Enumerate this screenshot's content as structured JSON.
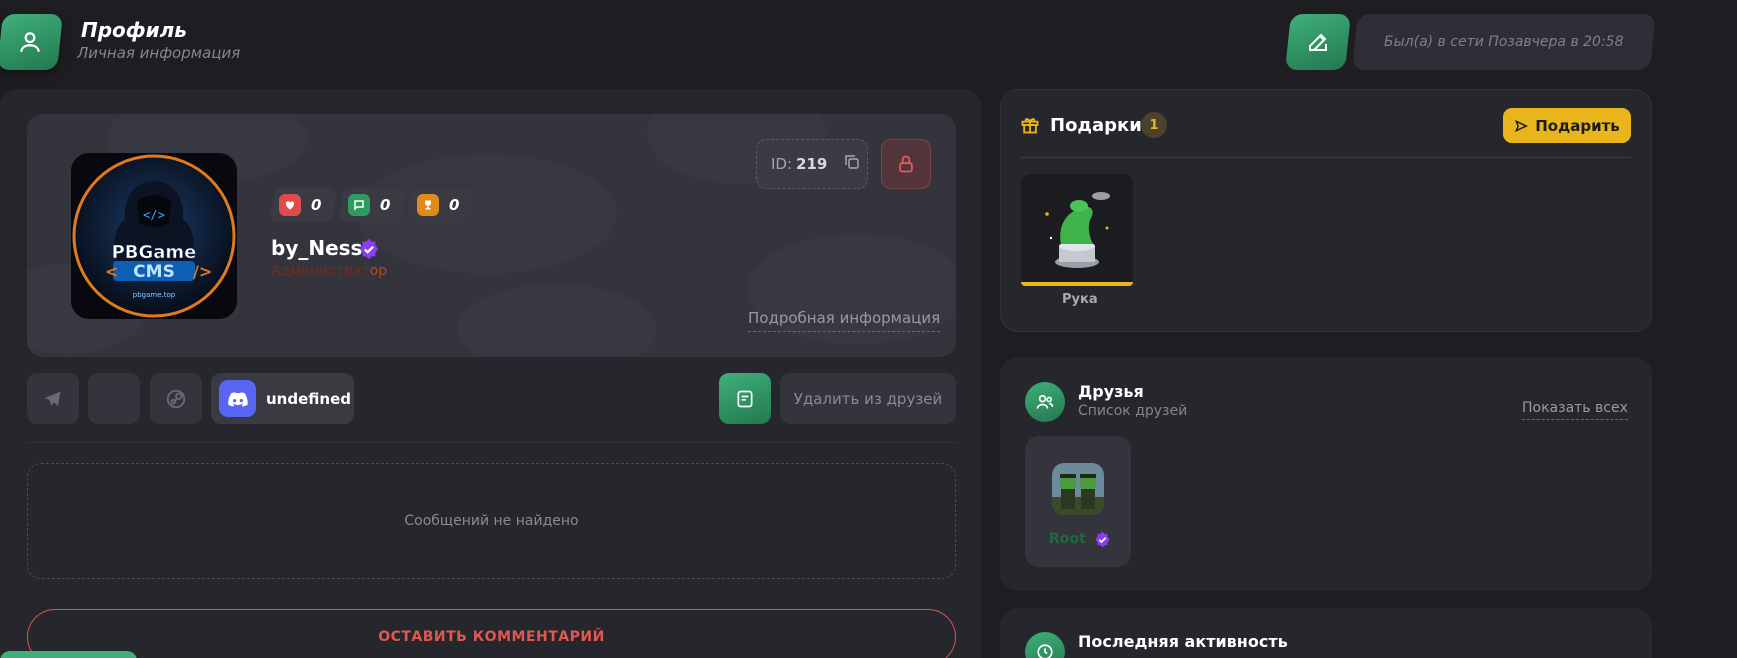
{
  "header": {
    "title": "Профиль",
    "subtitle": "Личная информация",
    "last_seen": "Был(а) в сети Позавчера в 20:58"
  },
  "profile": {
    "avatar_text_top": "PBGame",
    "avatar_text_bottom": "CMS",
    "avatar_site": "pbgame.top",
    "stats": {
      "likes": "0",
      "comments": "0",
      "trophies": "0"
    },
    "username": "by_Ness",
    "role_main": "Администрат",
    "role_tail": "ор",
    "id_label": "ID:",
    "id_value": "219",
    "more_info": "Подробная информация"
  },
  "socials": {
    "discord_value": "undefined",
    "unfriend_label": "Удалить из друзей"
  },
  "comments": {
    "empty_text": "Сообщений не найдено",
    "leave_comment_label": "ОСТАВИТЬ КОММЕНТАРИЙ"
  },
  "gifts": {
    "title": "Подарки",
    "count": "1",
    "give_label": "Подарить",
    "items": [
      {
        "name": "Рука"
      }
    ]
  },
  "friends": {
    "title": "Друзья",
    "subtitle": "Список друзей",
    "show_all": "Показать всех",
    "items": [
      {
        "name": "Root"
      }
    ]
  },
  "activity": {
    "title": "Последняя активность"
  },
  "colors": {
    "accent_green": "#3fb07a",
    "gift_yellow": "#e8b61c",
    "danger": "#e0584f",
    "discord": "#5865f2"
  }
}
